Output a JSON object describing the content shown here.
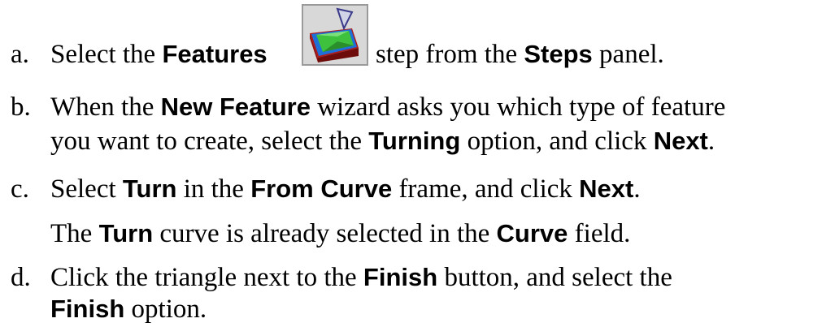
{
  "steps": [
    {
      "marker": "a.",
      "p1": "Select the ",
      "b1": "Features",
      "p2": " step from the ",
      "b2": "Steps",
      "p3": " panel.",
      "icon": "features-step-icon"
    },
    {
      "marker": "b.",
      "l1_p1": "When the ",
      "l1_b1": "New Feature",
      "l1_p2": " wizard asks you which type of feature",
      "l2_p1": "you want to create, select the ",
      "l2_b1": "Turning",
      "l2_p2": " option, and click ",
      "l2_b2": "Next",
      "l2_p3": "."
    },
    {
      "marker": "c.",
      "p1": "Select ",
      "b1": "Turn",
      "p2": " in the ",
      "b2": "From Curve",
      "p3": " frame, and click ",
      "b3": "Next",
      "p4": "."
    },
    {
      "note_p1": "The ",
      "note_b1": "Turn",
      "note_p2": " curve is already selected in the ",
      "note_b2": "Curve",
      "note_p3": " field."
    },
    {
      "marker": "d.",
      "l1_p1": "Click the triangle next to the ",
      "l1_b1": "Finish",
      "l1_p2": " button, and select the",
      "l2_b1": "Finish",
      "l2_p1": " option."
    }
  ]
}
